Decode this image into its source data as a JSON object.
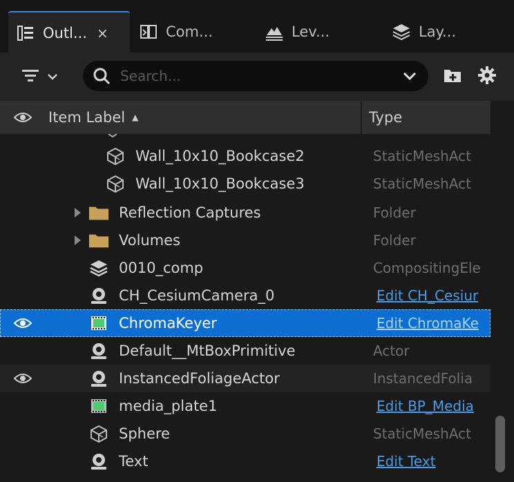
{
  "tabs": [
    {
      "label": "Outl...",
      "icon": "outliner-icon",
      "active": true,
      "close": "×"
    },
    {
      "label": "Com...",
      "icon": "components-icon",
      "active": false
    },
    {
      "label": "Lev...",
      "icon": "levels-icon",
      "active": false
    },
    {
      "label": "Lay...",
      "icon": "layers-icon",
      "active": false
    }
  ],
  "toolbar": {
    "search_placeholder": "Search..."
  },
  "header": {
    "item_label": "Item Label",
    "sort_indicator": "▲",
    "type": "Type"
  },
  "rows": [
    {
      "name": "Wall_10x10_Bookcase2",
      "type": "StaticMeshAct",
      "icon": "static-mesh-icon"
    },
    {
      "name": "Wall_10x10_Bookcase3",
      "type": "StaticMeshAct",
      "icon": "static-mesh-icon"
    },
    {
      "name": "Reflection Captures",
      "type": "Folder",
      "icon": "folder-icon"
    },
    {
      "name": "Volumes",
      "type": "Folder",
      "icon": "folder-icon"
    },
    {
      "name": "0010_comp",
      "type": "CompositingEle",
      "icon": "layers-icon"
    },
    {
      "name": "CH_CesiumCamera_0",
      "type": "Edit CH_Cesiur",
      "icon": "actor-icon"
    },
    {
      "name": "ChromaKeyer",
      "type": "Edit ChromaKe",
      "icon": "media-plate-icon"
    },
    {
      "name": "Default__MtBoxPrimitive",
      "type": "Actor",
      "icon": "actor-icon"
    },
    {
      "name": "InstancedFoliageActor",
      "type": "InstancedFolia",
      "icon": "actor-icon"
    },
    {
      "name": "media_plate1",
      "type": "Edit BP_Media",
      "icon": "media-plate-icon"
    },
    {
      "name": "Sphere",
      "type": "StaticMeshAct",
      "icon": "static-mesh-icon"
    },
    {
      "name": "Text",
      "type": "Edit Text",
      "icon": "actor-icon"
    }
  ],
  "colors": {
    "selection": "#0c6ed0",
    "link": "#4d9be6",
    "accent_tab": "#3d8bd9"
  }
}
